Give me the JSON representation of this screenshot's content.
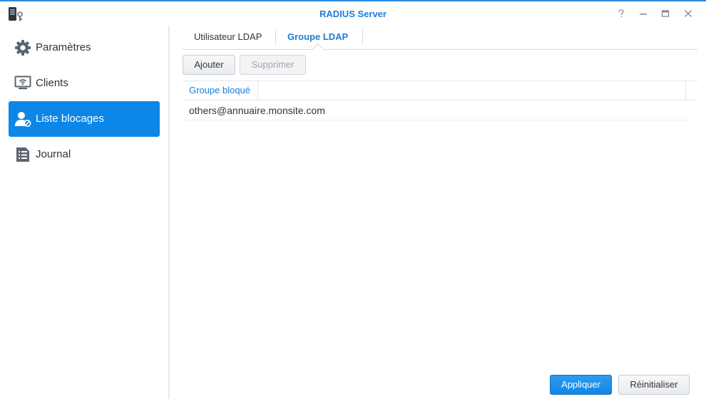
{
  "window": {
    "title": "RADIUS Server",
    "accent": "#1c7ed6"
  },
  "window_controls": [
    {
      "name": "help-button",
      "icon": "question-icon"
    },
    {
      "name": "minimize-button",
      "icon": "minimize-icon"
    },
    {
      "name": "maximize-button",
      "icon": "maximize-icon"
    },
    {
      "name": "close-button",
      "icon": "close-icon"
    }
  ],
  "sidebar": {
    "items": [
      {
        "label": "Paramètres",
        "icon": "gear-icon",
        "active": false
      },
      {
        "label": "Clients",
        "icon": "monitor-wifi-icon",
        "active": false
      },
      {
        "label": "Liste blocages",
        "icon": "user-blocked-icon",
        "active": true
      },
      {
        "label": "Journal",
        "icon": "log-list-icon",
        "active": false
      }
    ]
  },
  "tabs": [
    {
      "label": "Utilisateur LDAP",
      "active": false
    },
    {
      "label": "Groupe LDAP",
      "active": true
    }
  ],
  "toolbar": {
    "add_label": "Ajouter",
    "delete_label": "Supprimer"
  },
  "table": {
    "columns": [
      "Groupe bloqué"
    ],
    "rows": [
      [
        "others@annuaire.monsite.com"
      ]
    ]
  },
  "footer": {
    "apply_label": "Appliquer",
    "reset_label": "Réinitialiser"
  }
}
